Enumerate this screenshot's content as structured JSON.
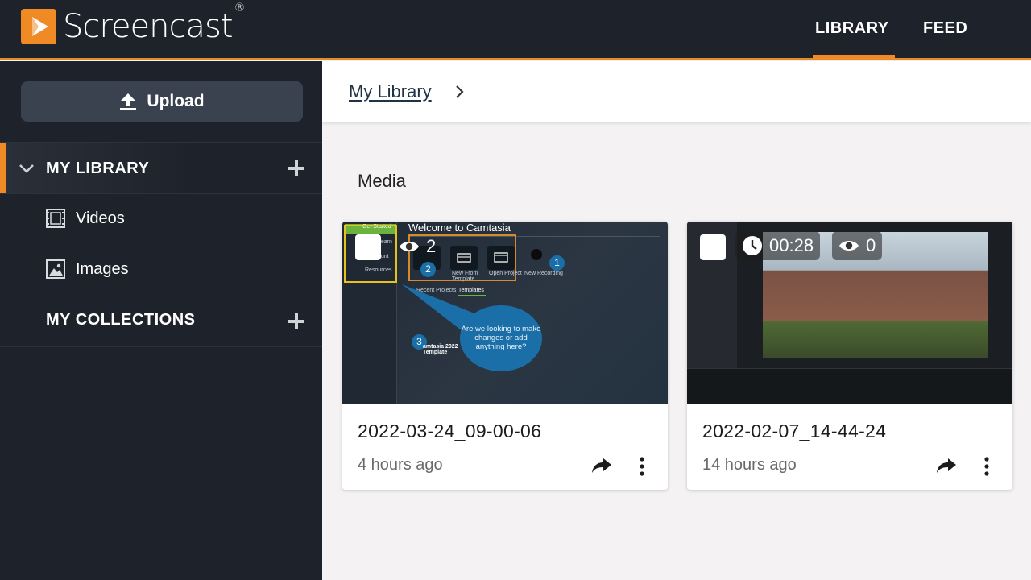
{
  "header": {
    "brand": "Screencast",
    "brand_mark": "®",
    "tabs": [
      {
        "label": "LIBRARY",
        "active": true
      },
      {
        "label": "FEED",
        "active": false
      }
    ],
    "accent_color": "#f08a24"
  },
  "sidebar": {
    "upload_label": "Upload",
    "my_library_label": "MY LIBRARY",
    "items": [
      {
        "label": "Videos",
        "icon": "film-icon"
      },
      {
        "label": "Images",
        "icon": "image-icon"
      }
    ],
    "collections_label": "MY COLLECTIONS"
  },
  "breadcrumb": {
    "link": "My Library"
  },
  "main": {
    "section_title": "Media",
    "cards": [
      {
        "title": "2022-03-24_09-00-06",
        "time": "4 hours ago",
        "views": "2",
        "thumb": {
          "welcome": "Welcome to Camtasia",
          "get_started": "Get Started",
          "nav_learn": "Learn",
          "nav_account": "ount",
          "nav_resources": "Resources",
          "tab_recent": "Recent Projects",
          "tab_templates": "Templates",
          "tile_new_template": "New From Template",
          "tile_open_project": "Open Project",
          "tile_new_recording": "New Recording",
          "bubble_text": "Are we looking to make changes or add anything here?",
          "template_name": "amtasia 2022 Template",
          "badges": [
            "1",
            "2",
            "3"
          ]
        }
      },
      {
        "title": "2022-02-07_14-44-24",
        "time": "14 hours ago",
        "duration": "00:28",
        "views": "0"
      }
    ]
  }
}
